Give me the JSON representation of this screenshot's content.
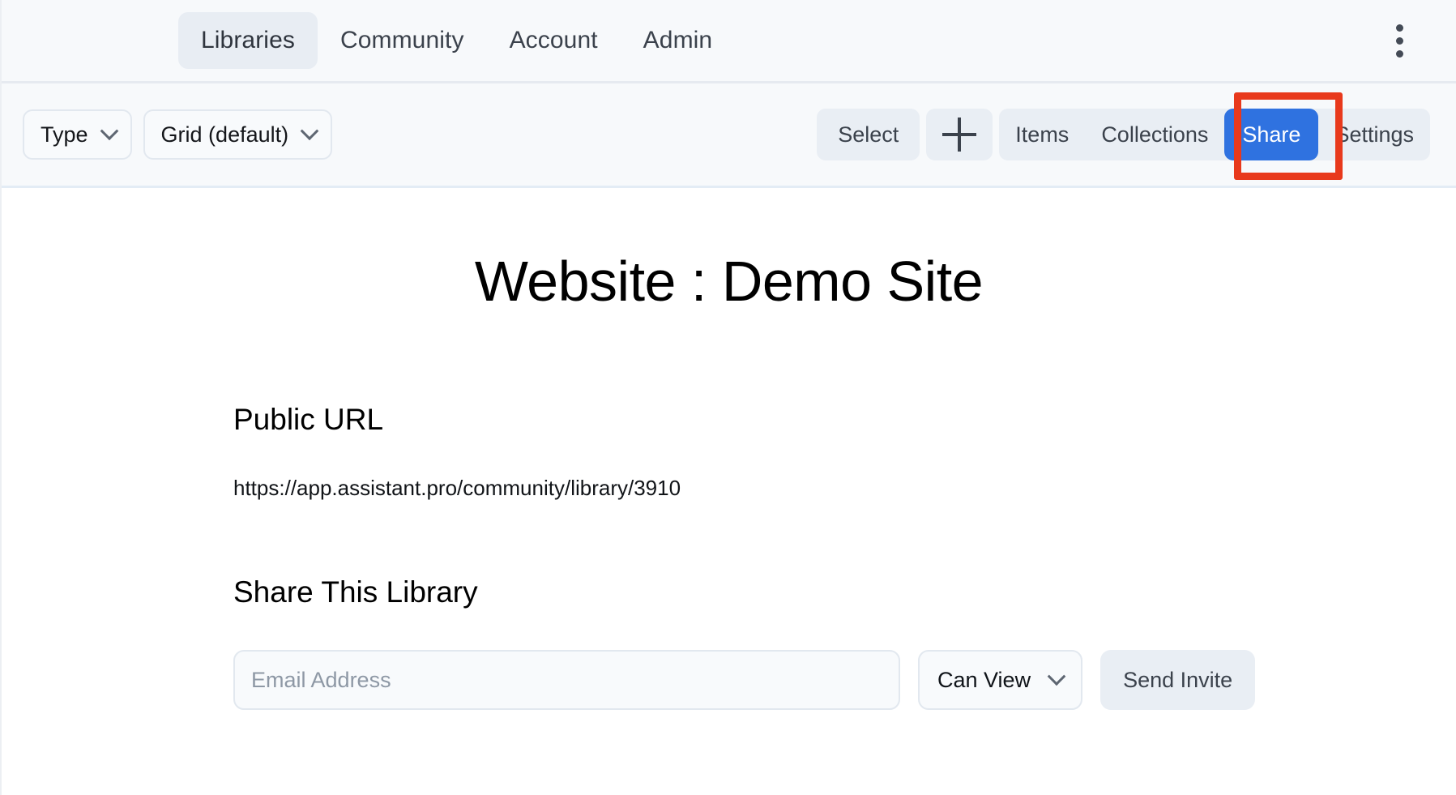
{
  "nav": {
    "tabs": [
      {
        "label": "Libraries",
        "active": true
      },
      {
        "label": "Community",
        "active": false
      },
      {
        "label": "Account",
        "active": false
      },
      {
        "label": "Admin",
        "active": false
      }
    ],
    "overflow_icon": "kebab-menu-icon"
  },
  "toolbar": {
    "type_filter": {
      "label": "Type",
      "icon": "chevron-down-icon"
    },
    "layout_filter": {
      "label": "Grid (default)",
      "icon": "chevron-down-icon"
    },
    "select_label": "Select",
    "add_icon": "plus-icon",
    "segments": [
      {
        "label": "Items",
        "active": false
      },
      {
        "label": "Collections",
        "active": false
      },
      {
        "label": "Share",
        "active": true
      },
      {
        "label": "Settings",
        "active": false
      }
    ],
    "highlight_color": "#e8391c",
    "active_segment_color": "#2f72e0"
  },
  "main": {
    "title": "Website : Demo Site",
    "public_url_heading": "Public URL",
    "public_url": "https://app.assistant.pro/community/library/3910",
    "share_heading": "Share This Library",
    "email_placeholder": "Email Address",
    "email_value": "",
    "permission_value": "Can View",
    "permission_icon": "chevron-down-icon",
    "send_invite_label": "Send Invite"
  }
}
